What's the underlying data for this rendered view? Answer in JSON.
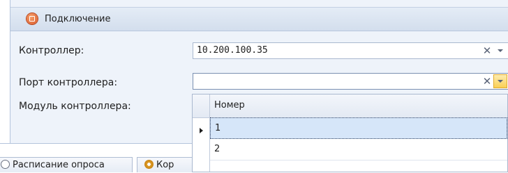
{
  "panel": {
    "title": "Подключение",
    "icon": "connection-icon"
  },
  "fields": {
    "controller": {
      "label": "Контроллер:",
      "value": "10.200.100.35"
    },
    "port": {
      "label": "Порт контроллера:",
      "value": ""
    },
    "module": {
      "label": "Модуль контроллера:"
    }
  },
  "dropdown": {
    "column_header": "Номер",
    "rows": [
      "1",
      "2"
    ],
    "selected_row": "1"
  },
  "tabs": [
    {
      "label": "Расписание опроса",
      "icon": "schedule-icon"
    },
    {
      "label": "Кор",
      "icon": "gear-icon"
    }
  ],
  "colors": {
    "panel_bg": "#eef3fa",
    "header_bg": "#d3deed",
    "active_dropdown_button": "#f9cf56",
    "selected_row_bg": "#d6e6f9"
  }
}
